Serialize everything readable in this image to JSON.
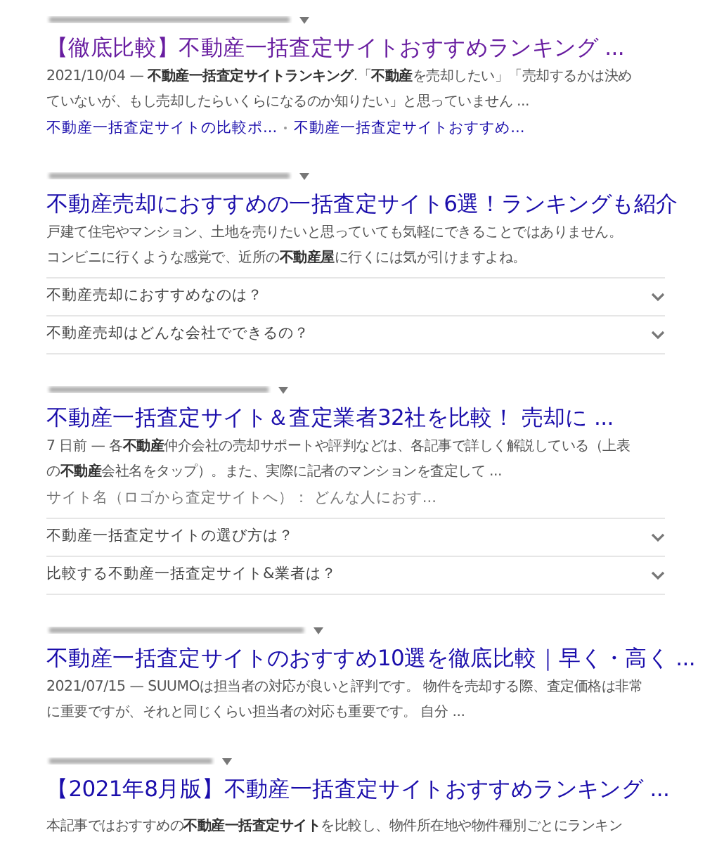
{
  "results": [
    {
      "visited": true,
      "title": "【徹底比較】不動産一括査定サイトおすすめランキング ...",
      "snippet": [
        "2021/10/04 — **不動産一括査定サイトランキング**.「**不動産**を売却したい」「売却するかは決め",
        "ていないが、もし売却したらいくらになるのか知りたい」と思っていません ..."
      ],
      "sitelinks": [
        "不動産一括査定サイトの比較ポ...",
        "不動産一括査定サイトおすすめ..."
      ]
    },
    {
      "visited": false,
      "title": "不動産売却におすすめの一括査定サイト6選！ランキングも紹介",
      "snippet": [
        "戸建て住宅やマンション、土地を売りたいと思っていても気軽にできることではありません。",
        "コンビニに行くような感覚で、近所の**不動産屋**に行くには気が引けますよね。"
      ],
      "questions": [
        {
          "text": "不動産売却におすすめなのは？",
          "expanded": false
        },
        {
          "text": "不動産売却はどんな会社でできるの？",
          "expanded": false
        }
      ]
    },
    {
      "visited": false,
      "title": "不動産一括査定サイト＆査定業者32社を比較！ 売却に ...",
      "snippet": [
        "7 日前 — 各**不動産**仲介会社の売却サポートや評判などは、各記事で詳しく解説している（上表",
        "の**不動産**会社名をタップ）。また、実際に記者のマンションを査定して ..."
      ],
      "note": "サイト名（ロゴから査定サイトへ）： どんな人におす...",
      "questions": [
        {
          "text": "不動産一括査定サイトの選び方は？",
          "expanded": false
        },
        {
          "text": "比較する不動産一括査定サイト&業者は？",
          "expanded": false
        }
      ]
    },
    {
      "visited": false,
      "title": "不動産一括査定サイトのおすすめ10選を徹底比較｜早く・高く ...",
      "snippet": [
        "2021/07/15 — SUUMOは担当者の対応が良いと評判です。 物件を売却する際、査定価格は非常",
        "に重要ですが、それと同じくらい担当者の対応も重要です。 自分 ..."
      ]
    },
    {
      "visited": false,
      "title": "【2021年8月版】不動産一括査定サイトおすすめランキング ...",
      "snippet": [
        "本記事ではおすすめの**不動産一括査定サイト**を比較し、物件所在地や物件種別ごとにランキン"
      ]
    }
  ]
}
